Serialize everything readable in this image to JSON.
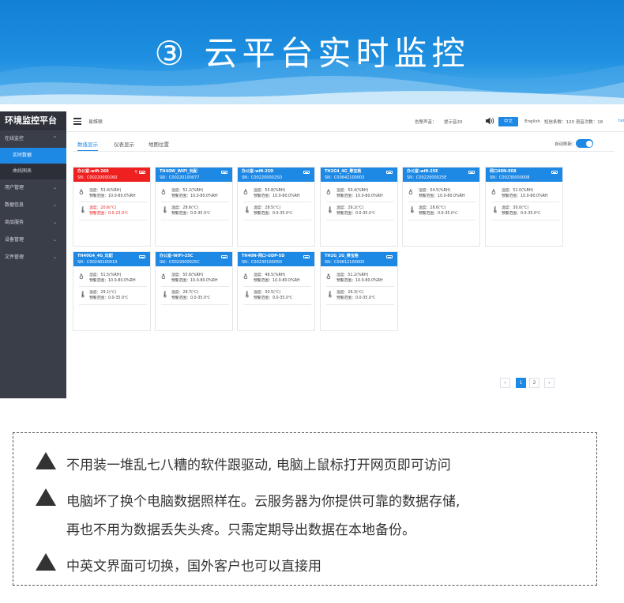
{
  "banner": {
    "title": "③  云平台实时监控"
  },
  "sidebar": {
    "brand": "环境监控平台",
    "groups": [
      {
        "label": "在线监控",
        "expanded": true
      },
      {
        "label": "用户管理"
      },
      {
        "label": "数据信息"
      },
      {
        "label": "商品服务"
      },
      {
        "label": "设备管理"
      },
      {
        "label": "文件管理"
      }
    ],
    "sub_items": [
      {
        "label": "实时数据",
        "active": true
      },
      {
        "label": "曲线图表",
        "active": false
      }
    ]
  },
  "topbar": {
    "user": "易维联",
    "alarm_sound_label": "告警声音：",
    "alarm_tone": "提示音20",
    "lang_zh": "中文",
    "lang_en": "English",
    "sms_info": "短信条数：120  语音次数：18",
    "link_text": "tan"
  },
  "tabs": [
    {
      "label": "数值显示",
      "active": true
    },
    {
      "label": "仪表显示",
      "active": false
    },
    {
      "label": "地图位置",
      "active": false
    }
  ],
  "auto_refresh": {
    "label": "自动刷新：",
    "enabled": true
  },
  "cards": [
    {
      "name": "办公室-wifi-260",
      "sn": "SN：C00220000260",
      "alarm": true,
      "hum": "湿度：53.4(%RH)",
      "hum_range": "预警范围：10.0-80.0%RH",
      "temp": "温度：20.6(℃)",
      "temp_range": "预警范围：0.0-23.0℃",
      "temp_alarm": true
    },
    {
      "name": "TH40W_WIFI_玩配",
      "sn": "SN：C00220100077",
      "alarm": false,
      "hum": "湿度：52.2(%RH)",
      "hum_range": "预警范围：10.0-80.0%RH",
      "temp": "温度：28.6(℃)",
      "temp_range": "预警范围：0.0-35.0℃",
      "temp_alarm": false
    },
    {
      "name": "办公室-wifi-25D",
      "sn": "SN：C0022000025D",
      "alarm": false,
      "hum": "湿度：55.8(%RH)",
      "hum_range": "预警范围：10.0-80.0%RH",
      "temp": "温度：28.5(℃)",
      "temp_range": "预警范围：0.0-35.0℃",
      "temp_alarm": false
    },
    {
      "name": "TH2G4_4G_尊宝格",
      "sn": "SN：C00642100003",
      "alarm": false,
      "hum": "湿度：50.4(%RH)",
      "hum_range": "预警范围：10.0-80.0%RH",
      "temp": "温度：29.2(℃)",
      "temp_range": "预警范围：0.0-35.0℃",
      "temp_alarm": false
    },
    {
      "name": "办公室-wifi-25E",
      "sn": "SN：C0022000025E",
      "alarm": false,
      "hum": "湿度：54.5(%RH)",
      "hum_range": "预警范围：10.0-80.0%RH",
      "temp": "温度：28.6(℃)",
      "temp_range": "预警范围：0.0-35.0℃",
      "temp_alarm": false
    },
    {
      "name": "网口40N-E08",
      "sn": "SN：C00230000008",
      "alarm": false,
      "hum": "湿度：52.0(%RH)",
      "hum_range": "预警范围：10.0-80.0%RH",
      "temp": "温度：30.0(℃)",
      "temp_range": "预警范围：0.0-35.0℃",
      "temp_alarm": false
    },
    {
      "name": "TH40G4_4G_玩配",
      "sn": "SN：C00240100010",
      "alarm": false,
      "hum": "湿度：51.5(%RH)",
      "hum_range": "预警范围：10.0-80.0%RH",
      "temp": "温度：29.1(℃)",
      "temp_range": "预警范围：0.0-35.0℃",
      "temp_alarm": false
    },
    {
      "name": "办公室-WIFI-25C",
      "sn": "SN：C0022000025C",
      "alarm": false,
      "hum": "湿度：55.6(%RH)",
      "hum_range": "预警范围：10.0-80.0%RH",
      "temp": "温度：28.7(℃)",
      "temp_range": "预警范围：0.0-35.0℃",
      "temp_alarm": false
    },
    {
      "name": "TH40N-网口-UDP-5D",
      "sn": "SN：C0023010005D",
      "alarm": false,
      "hum": "湿度：48.5(%RH)",
      "hum_range": "预警范围：10.0-80.0%RH",
      "temp": "温度：30.5(℃)",
      "temp_range": "预警范围：0.0-35.0℃",
      "temp_alarm": false
    },
    {
      "name": "TH2G_2G_尊宝格",
      "sn": "SN：C00612100000",
      "alarm": false,
      "hum": "湿度：51.2(%RH)",
      "hum_range": "预警范围：10.0-80.0%RH",
      "temp": "温度：29.3(℃)",
      "temp_range": "预警范围：0.0-35.0℃",
      "temp_alarm": false
    }
  ],
  "pagination": {
    "prev": "‹",
    "pages": [
      "1",
      "2"
    ],
    "current": "1",
    "next": "›"
  },
  "notes": [
    "不用装一堆乱七八糟的软件跟驱动, 电脑上鼠标打开网页即可访问",
    "电脑坏了换个电脑数据照样在。云服务器为你提供可靠的数据存储,",
    "再也不用为数据丢失头疼。只需定期导出数据在本地备份。",
    "中英文界面可切换，国外客户也可以直接用"
  ],
  "colors": {
    "accent": "#1e88e5",
    "alarm": "#ef2020",
    "sidebar": "#3a3e48",
    "banner": "#1380d6"
  }
}
